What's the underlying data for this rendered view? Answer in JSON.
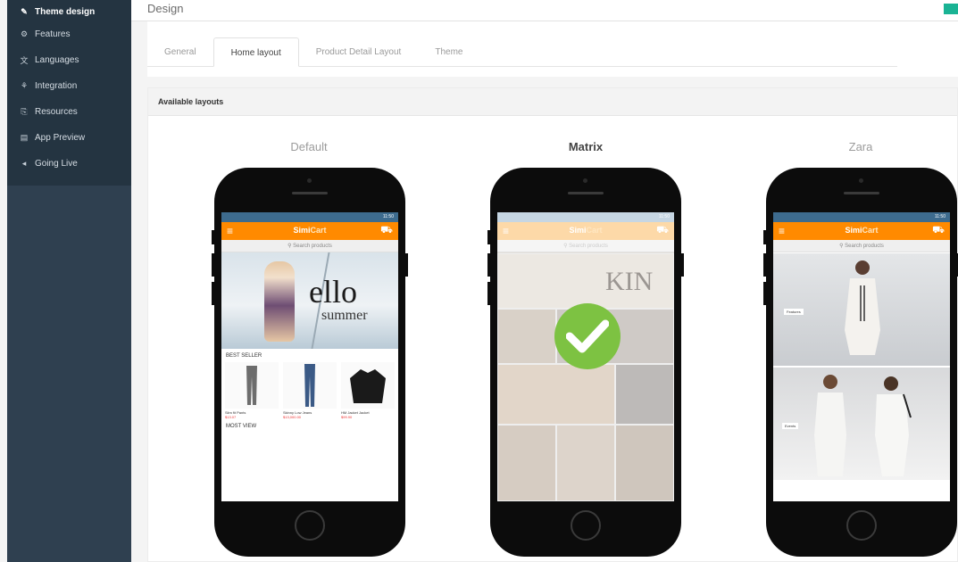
{
  "sidebar": {
    "items": [
      {
        "label": "Theme design",
        "icon": "brush-icon",
        "glyph": "✎",
        "active": true
      },
      {
        "label": "Features",
        "icon": "features-icon",
        "glyph": "⚙"
      },
      {
        "label": "Languages",
        "icon": "language-icon",
        "glyph": "文"
      },
      {
        "label": "Integration",
        "icon": "integration-icon",
        "glyph": "⚘"
      },
      {
        "label": "Resources",
        "icon": "resources-icon",
        "glyph": "⎘"
      },
      {
        "label": "App Preview",
        "icon": "preview-icon",
        "glyph": "▤"
      },
      {
        "label": "Going Live",
        "icon": "going-live-icon",
        "glyph": "◂"
      }
    ]
  },
  "header": {
    "title": "Design"
  },
  "tabs": [
    {
      "label": "General"
    },
    {
      "label": "Home layout",
      "active": true
    },
    {
      "label": "Product Detail Layout"
    },
    {
      "label": "Theme"
    }
  ],
  "layouts": {
    "section_title": "Available layouts",
    "options": [
      {
        "name": "Default"
      },
      {
        "name": "Matrix",
        "selected": true
      },
      {
        "name": "Zara"
      }
    ]
  },
  "preview": {
    "time": "11:50",
    "brand_part1": "Simi",
    "brand_part2": "Cart",
    "search_placeholder": "Search products",
    "hero_big": "ello",
    "hero_small": "summer",
    "best_seller_label": "BEST SELLER",
    "most_view_label": "MOST VIEW",
    "products": [
      {
        "name": "Slim fit Pants",
        "price": "$13.07"
      },
      {
        "name": "Skinny Low Jeans",
        "price": "$13,000.00"
      },
      {
        "name": "HM Jacket Jacket",
        "price": "$99.90"
      }
    ],
    "matrix_word": "KIN",
    "zara_labels": [
      "Features",
      "Events"
    ]
  },
  "colors": {
    "sidebar_bg": "#2f4050",
    "accent": "#1ab394",
    "app_orange": "#ff8a00",
    "check_green": "#7dc242"
  }
}
